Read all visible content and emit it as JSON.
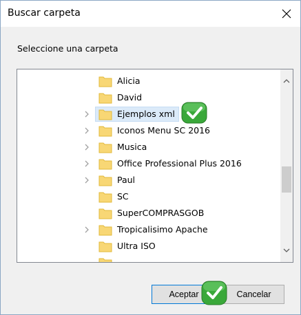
{
  "window": {
    "title": "Buscar carpeta"
  },
  "prompt": "Seleccione una carpeta",
  "tree": {
    "items": [
      {
        "label": "Alicia",
        "expandable": false
      },
      {
        "label": "David",
        "expandable": false
      },
      {
        "label": "Ejemplos xml",
        "expandable": true,
        "selected": true
      },
      {
        "label": "Iconos Menu SC 2016",
        "expandable": true
      },
      {
        "label": "Musica",
        "expandable": true
      },
      {
        "label": "Office Professional Plus 2016",
        "expandable": true
      },
      {
        "label": "Paul",
        "expandable": true
      },
      {
        "label": "SC",
        "expandable": false
      },
      {
        "label": "SuperCOMPRASGOB",
        "expandable": false
      },
      {
        "label": "Tropicalisimo Apache",
        "expandable": true
      },
      {
        "label": "Ultra ISO",
        "expandable": false
      }
    ]
  },
  "buttons": {
    "ok": "Aceptar",
    "cancel": "Cancelar"
  },
  "colors": {
    "accent": "#0078d7",
    "checkmark": "#3aa83a",
    "selection": "#dbeaf9",
    "folder": "#f8d775"
  },
  "icons": {
    "close": "close-icon",
    "folder": "folder-icon",
    "check": "checkmark-badge-icon"
  }
}
